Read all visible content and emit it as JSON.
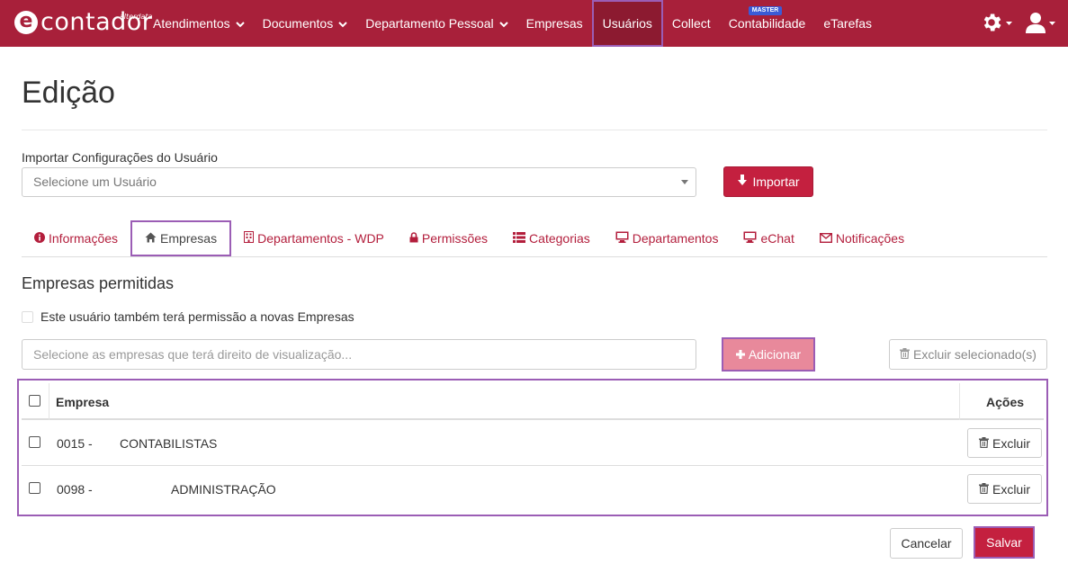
{
  "brand": {
    "logo_letter": "e",
    "logo_word": "contador",
    "logo_small": "alterdata"
  },
  "nav": {
    "items": [
      {
        "label": "Atendimentos",
        "dropdown": true
      },
      {
        "label": "Documentos",
        "dropdown": true
      },
      {
        "label": "Departamento Pessoal",
        "dropdown": true
      },
      {
        "label": "Empresas",
        "dropdown": false
      },
      {
        "label": "Usuários",
        "dropdown": false,
        "active": true
      },
      {
        "label": "Collect",
        "dropdown": false
      },
      {
        "label": "Contabilidade",
        "dropdown": false,
        "badge": "MASTER"
      },
      {
        "label": "eTarefas",
        "dropdown": false
      }
    ],
    "right_icons": [
      "gear-icon",
      "user-icon"
    ]
  },
  "page": {
    "title": "Edição"
  },
  "import": {
    "label": "Importar Configurações do Usuário",
    "select_placeholder": "Selecione um Usuário",
    "button_label": "Importar"
  },
  "tabs": [
    {
      "label": "Informações",
      "icon": "info-icon"
    },
    {
      "label": "Empresas",
      "icon": "home-icon",
      "active": true
    },
    {
      "label": "Departamentos - WDP",
      "icon": "building-icon"
    },
    {
      "label": "Permissões",
      "icon": "lock-icon"
    },
    {
      "label": "Categorias",
      "icon": "list-icon"
    },
    {
      "label": "Departamentos",
      "icon": "monitor-icon"
    },
    {
      "label": "eChat",
      "icon": "monitor-icon"
    },
    {
      "label": "Notificações",
      "icon": "envelope-icon"
    }
  ],
  "companies": {
    "section_title": "Empresas permitidas",
    "new_permission_label": "Este usuário também terá permissão a novas Empresas",
    "search_placeholder": "Selecione as empresas que terá direito de visualização...",
    "add_label": "Adicionar",
    "delete_selected_label": "Excluir selecionado(s)",
    "table": {
      "col_company": "Empresa",
      "col_actions": "Ações",
      "rows": [
        {
          "code": "0015 -",
          "name": "CONTABILISTAS",
          "action": "Excluir"
        },
        {
          "code": "0098 -",
          "name": "ADMINISTRAÇÃO",
          "action": "Excluir"
        }
      ]
    }
  },
  "footer": {
    "cancel_label": "Cancelar",
    "save_label": "Salvar"
  },
  "colors": {
    "brand": "#a8203a",
    "accent": "#c4203f",
    "highlight": "#9b5db5"
  }
}
